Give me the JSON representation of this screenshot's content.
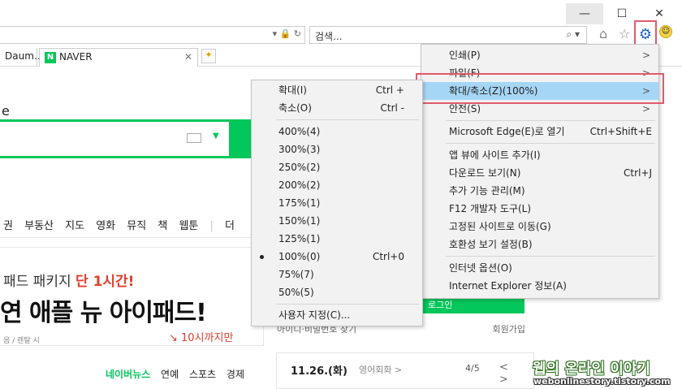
{
  "window": {
    "minimize_icon": "minimize-icon",
    "maximize_icon": "maximize-icon",
    "close_icon": "close-icon",
    "min_glyph": "—",
    "max_glyph": "☐",
    "close_glyph": "✕"
  },
  "toolbar": {
    "search_placeholder": "검색...",
    "search_glyph": "⌕ ▾",
    "addr_glyphs": "▾ 🔒 ↻",
    "home_glyph": "⌂",
    "star_glyph": "☆",
    "gear_glyph": "⚙",
    "smiley_glyph": "☺"
  },
  "tabs": [
    {
      "label": "Daum..."
    },
    {
      "label": "NAVER",
      "logo": "N",
      "close": "✕"
    }
  ],
  "page": {
    "frag_heading": "e",
    "nav_items": [
      "권",
      "부동산",
      "지도",
      "영화",
      "뮤직",
      "책",
      "웹툰",
      "|",
      "더"
    ],
    "ad_line_pre": "패드 패키지 ",
    "ad_line_red": "단 1시간!",
    "ad_big": "연 애플 뉴 아이패드!",
    "ad_sub": "음 / 렌탈 시",
    "ad_time": "↘ 10시까지만",
    "news_items": [
      "네이버뉴스",
      "연예",
      "스포츠",
      "경제"
    ],
    "login_text": "로그인",
    "login_find": "아이디·비밀번호 찾기",
    "login_join": "회원가입",
    "date": "11.26.(화)",
    "date_cat": "영어회화 >",
    "page_num": "4/5",
    "page_nav": "< >",
    "watermark_title": "웹의 온라인 이야기",
    "watermark_url": "webonlinestory.tistory.com"
  },
  "main_menu": {
    "items": [
      {
        "label": "인쇄(P)",
        "arrow": ">"
      },
      {
        "label": "파일(F)",
        "arrow": ">"
      },
      {
        "label": "확대/축소(Z)(100%)",
        "arrow": ">",
        "selected": true
      },
      {
        "label": "안전(S)",
        "arrow": ">"
      },
      {
        "label": "Microsoft Edge(E)로 열기",
        "shortcut": "Ctrl+Shift+E"
      },
      {
        "label": "앱 뷰에 사이트 추가(I)"
      },
      {
        "label": "다운로드 보기(N)",
        "shortcut": "Ctrl+J"
      },
      {
        "label": "추가 기능 관리(M)"
      },
      {
        "label": "F12 개발자 도구(L)"
      },
      {
        "label": "고정된 사이트로 이동(G)"
      },
      {
        "label": "호환성 보기 설정(B)"
      },
      {
        "label": "인터넷 옵션(O)"
      },
      {
        "label": "Internet Explorer 정보(A)"
      }
    ]
  },
  "zoom_menu": {
    "items": [
      {
        "label": "확대(I)",
        "shortcut": "Ctrl +"
      },
      {
        "label": "축소(O)",
        "shortcut": "Ctrl -"
      },
      {
        "label": "400%(4)"
      },
      {
        "label": "300%(3)"
      },
      {
        "label": "250%(2)"
      },
      {
        "label": "200%(2)"
      },
      {
        "label": "175%(1)"
      },
      {
        "label": "150%(1)"
      },
      {
        "label": "125%(1)"
      },
      {
        "label": "100%(0)",
        "shortcut": "Ctrl+0",
        "checked": true
      },
      {
        "label": "75%(7)"
      },
      {
        "label": "50%(5)"
      },
      {
        "label": "사용자 지정(C)..."
      }
    ]
  }
}
